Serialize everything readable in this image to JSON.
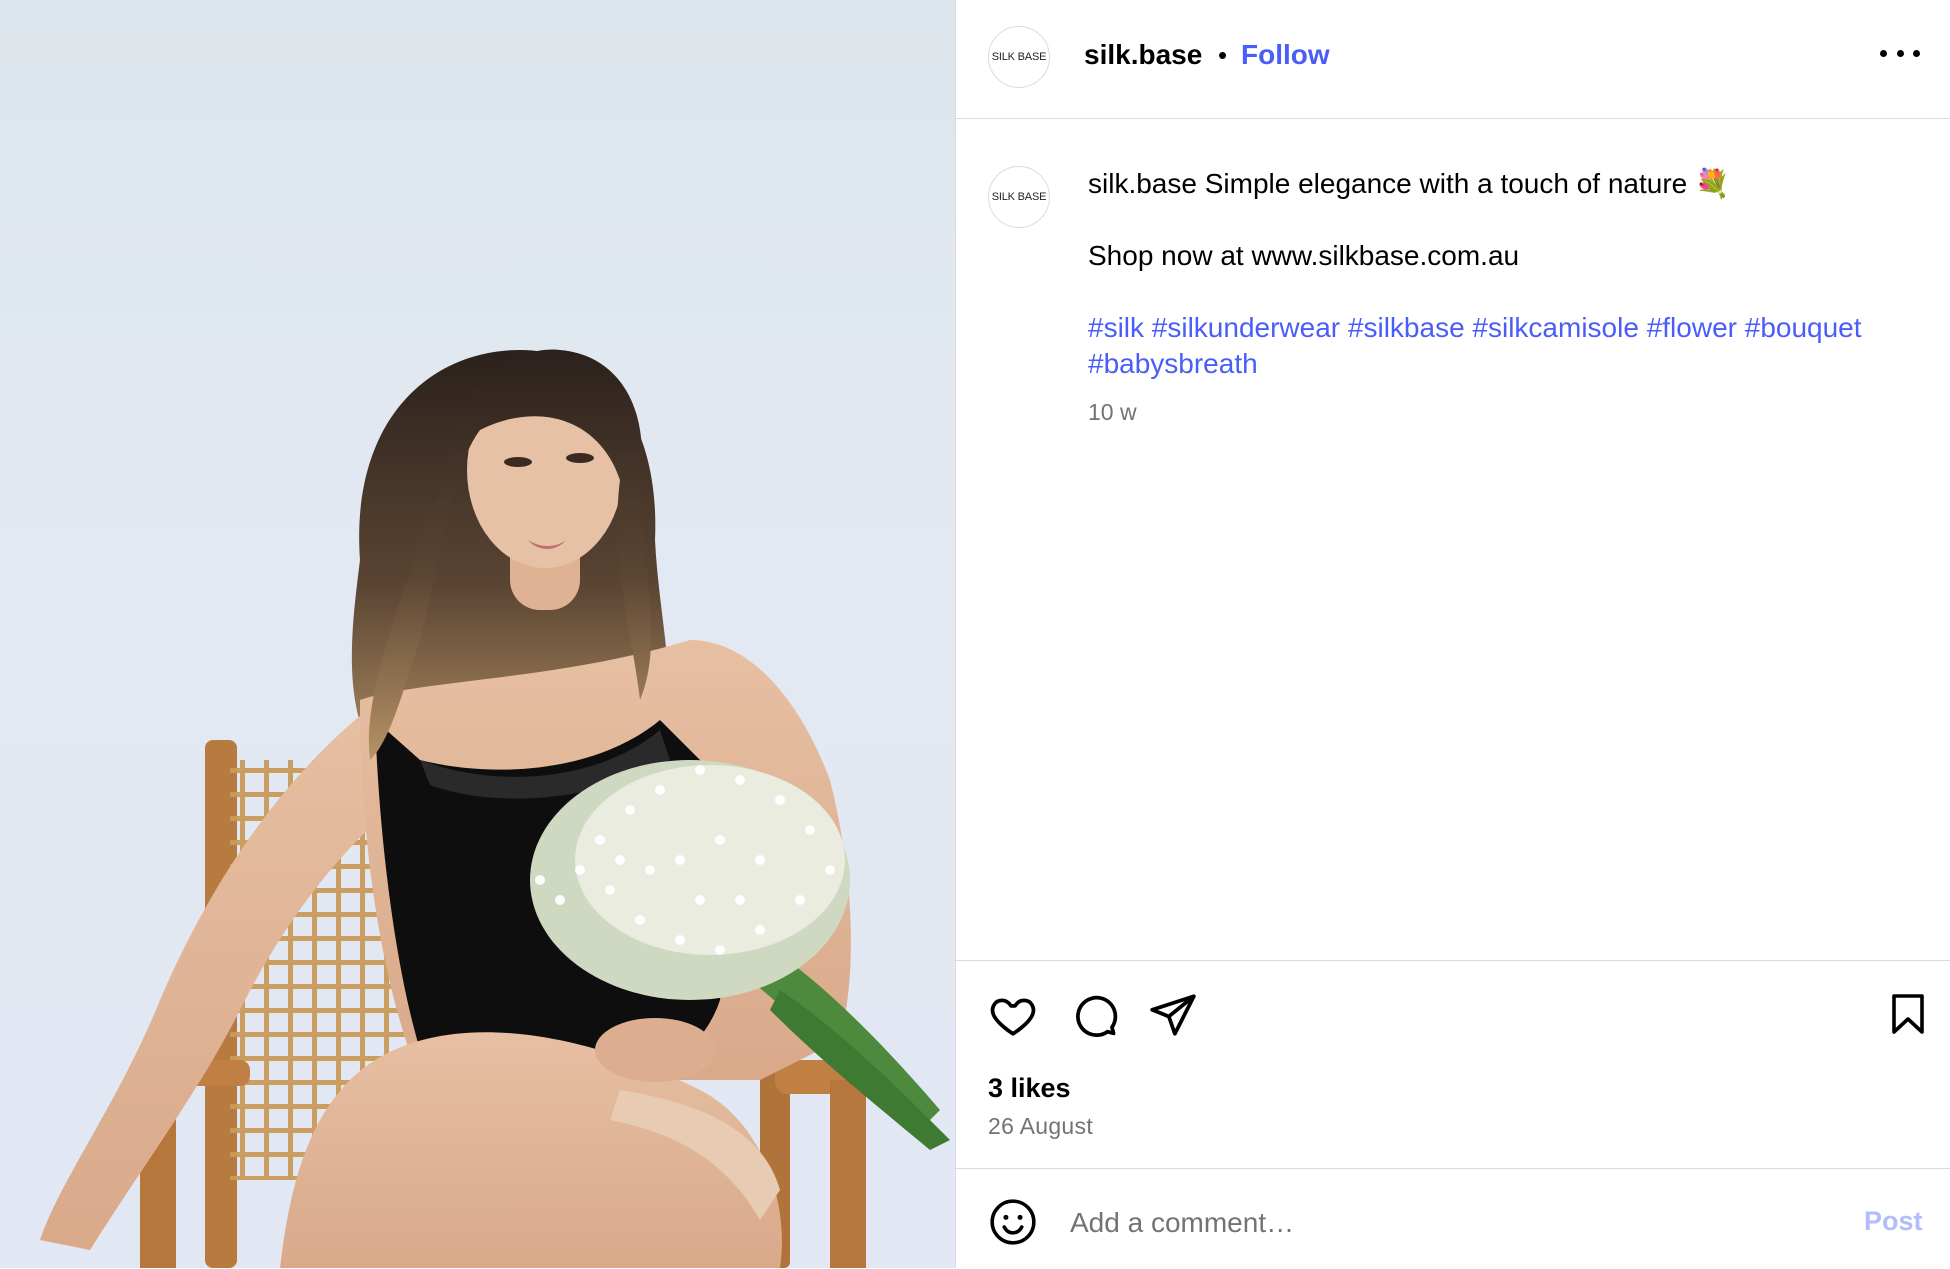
{
  "post": {
    "username": "silk.base",
    "avatar_text": "SILK BASE",
    "separator": "•",
    "follow_label": "Follow",
    "more_icon": "more-horizontal-icon",
    "caption": {
      "username": "silk.base",
      "text": "Simple elegance with a touch of nature 💐",
      "line2": "Shop now at www.silkbase.com.au",
      "hashtags": [
        "#silk",
        "#silkunderwear",
        "#silkbase",
        "#silkcamisole",
        "#flower",
        "#bouquet",
        "#babysbreath"
      ]
    },
    "time_ago": "10 w",
    "actions": {
      "like_icon": "heart-icon",
      "comment_icon": "comment-bubble-icon",
      "share_icon": "paper-plane-icon",
      "save_icon": "bookmark-icon"
    },
    "likes": "3 likes",
    "date": "26 August",
    "comment": {
      "emoji_icon": "smiley-icon",
      "placeholder": "Add a comment…",
      "post_label": "Post"
    }
  },
  "colors": {
    "link_blue": "#4a5df9",
    "post_disabled": "#b3bdfc",
    "muted": "#737373",
    "divider": "#dbdbdb"
  }
}
